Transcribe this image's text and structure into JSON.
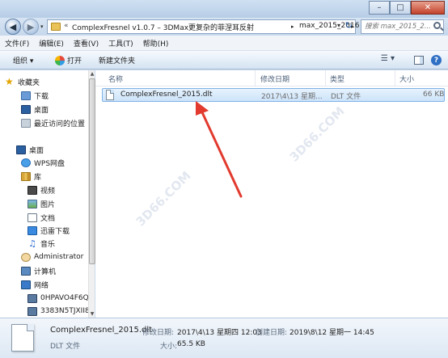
{
  "window": {
    "minimize": "–",
    "maximize": "□",
    "close": "✕"
  },
  "address": {
    "root_chevron": "«",
    "crumbs": [
      "ComplexFresnel v1.0.7 – 3DMax更复杂的菲涅耳反射",
      "max_2015_2016"
    ],
    "separator": "▸",
    "dropdown": "▾",
    "refresh": "↻"
  },
  "search": {
    "placeholder": "搜索 max_2015_2..."
  },
  "menu": [
    "文件(F)",
    "编辑(E)",
    "查看(V)",
    "工具(T)",
    "帮助(H)"
  ],
  "toolbar": {
    "organize": "组织 ▾",
    "open": "打开",
    "new_folder": "新建文件夹",
    "view": "☰ ▾",
    "help": "?"
  },
  "nav": {
    "favorites": "收藏夹",
    "downloads": "下载",
    "desktop_fav": "桌面",
    "recent": "最近访问的位置",
    "desktop": "桌面",
    "wps": "WPS网盘",
    "libraries": "库",
    "videos": "视频",
    "pictures": "图片",
    "documents": "文档",
    "xunlei": "迅雷下载",
    "music": "音乐",
    "admin": "Administrator",
    "computer": "计算机",
    "network": "网络",
    "pc1": "0HPAVO4F6Q",
    "pc2": "3383N5TJXII8"
  },
  "columns": {
    "name": "名称",
    "modified": "修改日期",
    "type": "类型",
    "size": "大小"
  },
  "file": {
    "name": "ComplexFresnel_2015.dlt",
    "modified": "2017\\4\\13 星期...",
    "type": "DLT 文件",
    "size": "66 KB"
  },
  "watermarks": [
    "3D66.COM",
    "3D66.COM"
  ],
  "details": {
    "name": "ComplexFresnel_2015.dlt",
    "modified_label": "修改日期:",
    "modified_value": "2017\\4\\13 星期四 12:03",
    "created_label": "创建日期:",
    "created_value": "2019\\8\\12 星期一 14:45",
    "type": "DLT 文件",
    "size_label": "大小:",
    "size_value": "65.5 KB"
  },
  "colors": {
    "arrow": "#e23a2e",
    "selection": "#cde4fa"
  }
}
